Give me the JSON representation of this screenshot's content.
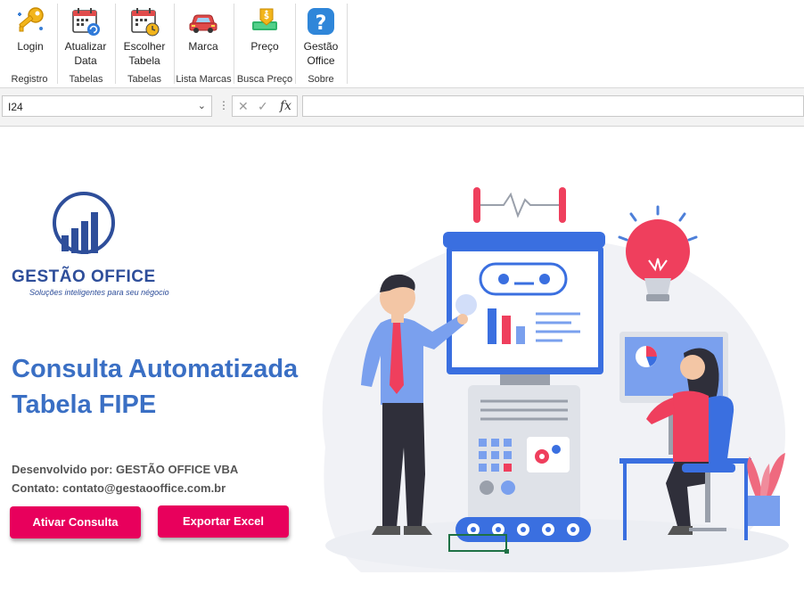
{
  "ribbon": {
    "groups": [
      {
        "label": "Registro",
        "buttons": [
          {
            "line1": "Login",
            "line2": "",
            "icon": "key-icon"
          }
        ]
      },
      {
        "label": "Tabelas",
        "buttons": [
          {
            "line1": "Atualizar",
            "line2": "Data",
            "icon": "calendar-refresh-icon"
          }
        ]
      },
      {
        "label": "Tabelas",
        "buttons": [
          {
            "line1": "Escolher",
            "line2": "Tabela",
            "icon": "calendar-clock-icon"
          }
        ]
      },
      {
        "label": "Lista Marcas",
        "buttons": [
          {
            "line1": "Marca",
            "line2": "",
            "icon": "car-icon"
          }
        ]
      },
      {
        "label": "Busca Preço",
        "buttons": [
          {
            "line1": "Preço",
            "line2": "",
            "icon": "price-tag-icon"
          }
        ]
      },
      {
        "label": "Sobre",
        "buttons": [
          {
            "line1": "Gestão",
            "line2": "Office",
            "icon": "help-icon"
          }
        ]
      }
    ]
  },
  "formula_bar": {
    "name_box": "I24",
    "formula": ""
  },
  "sheet": {
    "brand": {
      "name": "GESTÃO OFFICE",
      "tagline": "Soluções inteligentes para seu négocio"
    },
    "title_line1": "Consulta Automatizada",
    "title_line2": "Tabela FIPE",
    "developer": "Desenvolvido por: GESTÃO OFFICE VBA",
    "contact": "Contato: contato@gestaooffice.com.br",
    "btn_consulta": "Ativar Consulta",
    "btn_exportar": "Exportar Excel"
  },
  "colors": {
    "accent_pink": "#e8005c",
    "brand_blue": "#2e4e9a",
    "title_blue": "#3a6fc4",
    "cell_select": "#1e7145"
  }
}
